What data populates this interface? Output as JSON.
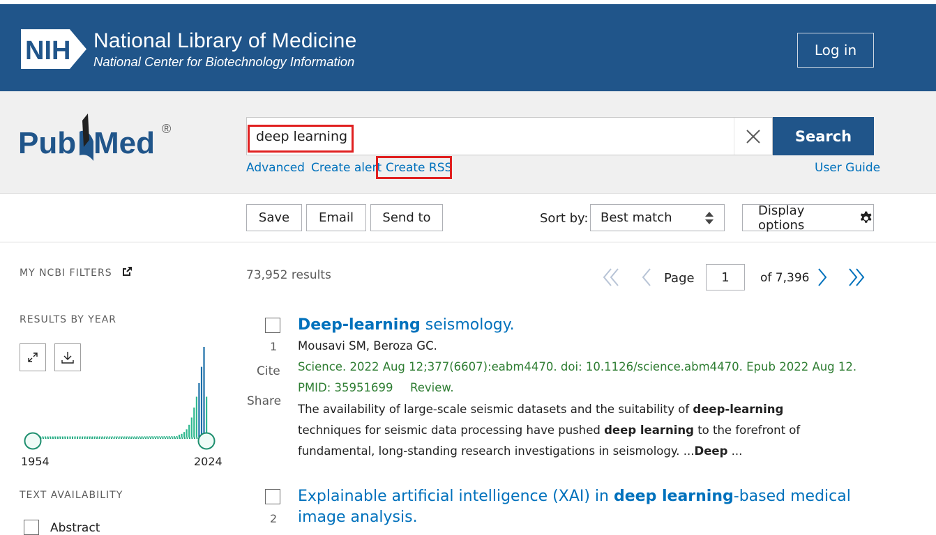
{
  "header": {
    "logo_text": "NIH",
    "title": "National Library of Medicine",
    "subtitle": "National Center for Biotechnology Information",
    "login_label": "Log in"
  },
  "search": {
    "logo_text": "PubMed",
    "query": "deep learning",
    "button_label": "Search",
    "links": {
      "advanced": "Advanced",
      "create_alert": "Create alert",
      "create_rss": "Create RSS",
      "user_guide": "User Guide"
    }
  },
  "toolbar": {
    "save": "Save",
    "email": "Email",
    "send_to": "Send to",
    "sort_label": "Sort by:",
    "sort_value": "Best match",
    "display_options": "Display options"
  },
  "sidebar": {
    "my_ncbi_filters": "MY NCBI FILTERS",
    "results_by_year": "RESULTS BY YEAR",
    "year_start": "1954",
    "year_end": "2024",
    "text_availability": "TEXT AVAILABILITY",
    "abstract_label": "Abstract"
  },
  "results_meta": {
    "count": "73,952 results",
    "page_label": "Page",
    "page_value": "1",
    "page_of": "of 7,396"
  },
  "results": [
    {
      "number": "1",
      "title_bold": "Deep-learning",
      "title_rest": " seismology.",
      "authors": "Mousavi SM, Beroza GC.",
      "citation": "Science. 2022 Aug 12;377(6607):eabm4470. doi: 10.1126/science.abm4470. Epub 2022 Aug 12.",
      "pmid": "PMID: 35951699",
      "type": "Review.",
      "cite": "Cite",
      "share": "Share",
      "snippet_1": "The availability of large-scale seismic datasets and the suitability of ",
      "snippet_b1": "deep-learning",
      "snippet_2": " techniques for seismic data processing have pushed ",
      "snippet_b2": "deep learning",
      "snippet_3": " to the forefront of fundamental, long-standing research investigations in seismology. ...",
      "snippet_b3": "Deep",
      "snippet_4": " ..."
    },
    {
      "number": "2",
      "title_1": "Explainable artificial intelligence (XAI) in ",
      "title_bold": "deep learning",
      "title_2": "-based medical image analysis."
    }
  ],
  "chart_data": {
    "type": "bar",
    "x": [
      "1954",
      "2024"
    ],
    "values": [
      0,
      1,
      2,
      4,
      7,
      12,
      19,
      28,
      39,
      58,
      85,
      100
    ],
    "note": ""
  }
}
